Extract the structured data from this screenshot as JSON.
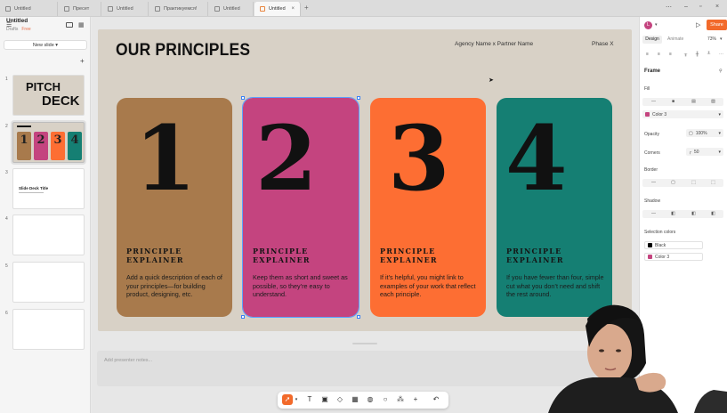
{
  "browser": {
    "tabs": [
      "Untitled",
      "Пресет",
      "Untitled",
      "Практикуемся!",
      "Untitled",
      "Untitled"
    ],
    "active_tab_index": 5
  },
  "file": {
    "title": "Untitled",
    "drafts": "Drafts",
    "plan": "Free"
  },
  "left_panel": {
    "new_slide_label": "New slide",
    "slide_numbers": [
      "1",
      "2",
      "3",
      "4",
      "5",
      "6"
    ],
    "thumb1": {
      "line1": "PITCH",
      "line2": "DECK"
    },
    "thumb3": {
      "title": "Slide Deck Title"
    }
  },
  "slide": {
    "title": "OUR PRINCIPLES",
    "agency": "Agency Name x Partner Name",
    "phase": "Phase X",
    "cards": [
      {
        "number": "1",
        "heading_line1": "PRINCIPLE",
        "heading_line2": "EXPLAINER",
        "description": "Add a quick description of each of your principles—for building product, designing, etc.",
        "color": "#a87a4c"
      },
      {
        "number": "2",
        "heading_line1": "PRINCIPLE",
        "heading_line2": "EXPLAINER",
        "description": "Keep them as short and sweet as possible, so they’re easy to understand.",
        "color": "#c4447f"
      },
      {
        "number": "3",
        "heading_line1": "PRINCIPLE",
        "heading_line2": "EXPLAINER",
        "description": "If it’s helpful, you might link to examples of your work that reflect each principle.",
        "color": "#fd6e33"
      },
      {
        "number": "4",
        "heading_line1": "PRINCIPLE",
        "heading_line2": "EXPLAINER",
        "description": "If you have fewer than four, simple cut what you don’t need and shift the rest around.",
        "color": "#157f73"
      }
    ]
  },
  "notes": {
    "placeholder": "Add presenter notes..."
  },
  "right_panel": {
    "avatar_initial": "L",
    "share_label": "Share",
    "tabs": [
      "Design",
      "Animate"
    ],
    "zoom": "73%",
    "frame_label": "Frame",
    "fill_label": "Fill",
    "fill_value": "Color 3",
    "opacity_label": "Opacity",
    "opacity_value": "100%",
    "corners_label": "Corners",
    "corners_value": "50",
    "border_label": "Border",
    "shadow_label": "Shadow",
    "selection_colors_label": "Selection colors",
    "selection_colors": [
      {
        "name": "Black",
        "color": "#000000"
      },
      {
        "name": "Color 3",
        "color": "#c4447f"
      }
    ]
  },
  "colors": {
    "accent": "#f26a2b",
    "slide_bg": "#d8d1c6",
    "selection": "#3b82f6"
  }
}
